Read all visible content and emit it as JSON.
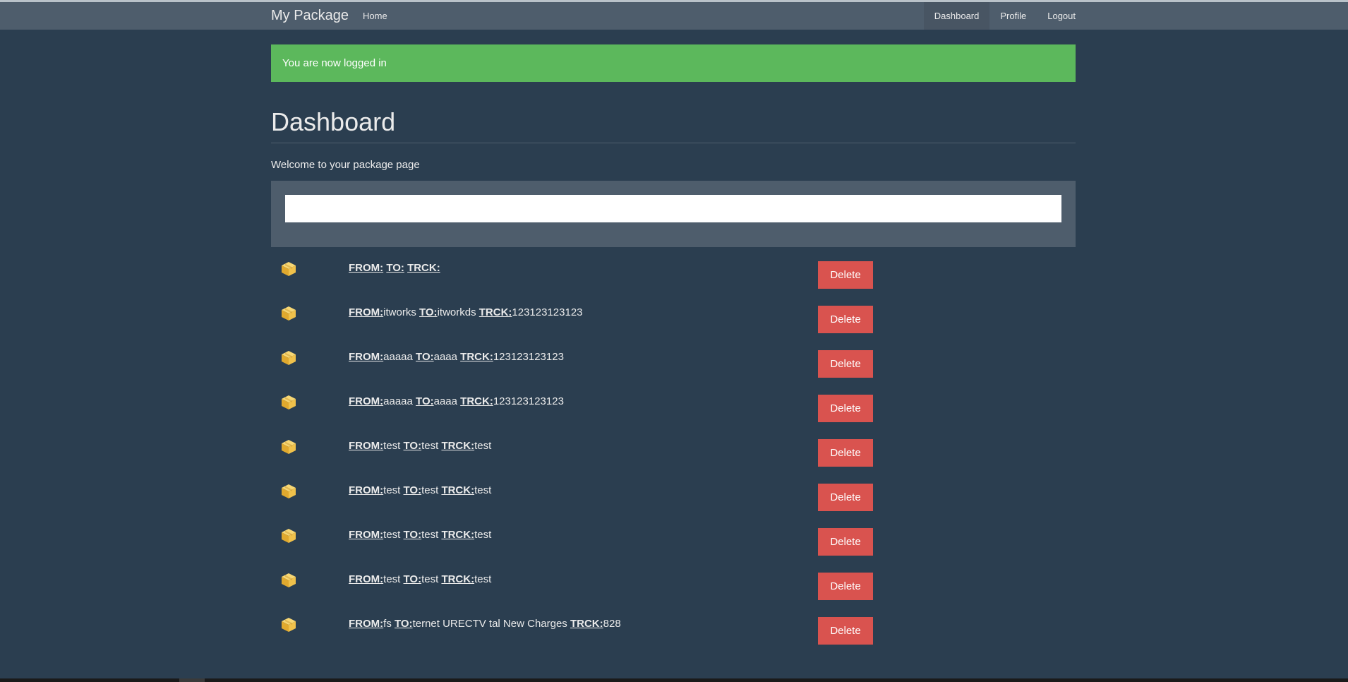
{
  "navbar": {
    "brand": "My Package",
    "left_links": [
      {
        "label": "Home"
      }
    ],
    "right_links": [
      {
        "label": "Dashboard",
        "active": true
      },
      {
        "label": "Profile",
        "active": false
      },
      {
        "label": "Logout",
        "active": false
      }
    ]
  },
  "alert": {
    "message": "You are now logged in",
    "color": "#5cb85c"
  },
  "main": {
    "title": "Dashboard",
    "welcome": "Welcome to your package page",
    "search": {
      "value": "",
      "placeholder": ""
    }
  },
  "labels": {
    "from": "FROM:",
    "to": "TO:",
    "trck": "TRCK:"
  },
  "packages": [
    {
      "icon": "package-box-icon",
      "from": "",
      "to": "",
      "trck": "",
      "delete_label": "Delete"
    },
    {
      "icon": "package-box-icon",
      "from": "itworks",
      "to": "itworkds",
      "trck": "123123123123",
      "delete_label": "Delete"
    },
    {
      "icon": "package-box-icon",
      "from": "aaaaa",
      "to": "aaaa",
      "trck": "123123123123",
      "delete_label": "Delete"
    },
    {
      "icon": "package-box-icon",
      "from": "aaaaa",
      "to": "aaaa",
      "trck": "123123123123",
      "delete_label": "Delete"
    },
    {
      "icon": "package-box-icon",
      "from": "test",
      "to": "test",
      "trck": "test",
      "delete_label": "Delete"
    },
    {
      "icon": "package-box-icon",
      "from": "test",
      "to": "test",
      "trck": "test",
      "delete_label": "Delete"
    },
    {
      "icon": "package-box-icon",
      "from": "test",
      "to": "test",
      "trck": "test",
      "delete_label": "Delete"
    },
    {
      "icon": "package-box-icon",
      "from": "test",
      "to": "test",
      "trck": "test",
      "delete_label": "Delete"
    },
    {
      "icon": "package-box-icon",
      "from": "fs",
      "to": "ternet URECTV tal New Charges",
      "trck": "828",
      "delete_label": "Delete"
    }
  ],
  "colors": {
    "background": "#2b3e50",
    "navbar": "#4e5d6c",
    "danger": "#d9534f",
    "success": "#5cb85c",
    "icon": "#f0c14b"
  }
}
